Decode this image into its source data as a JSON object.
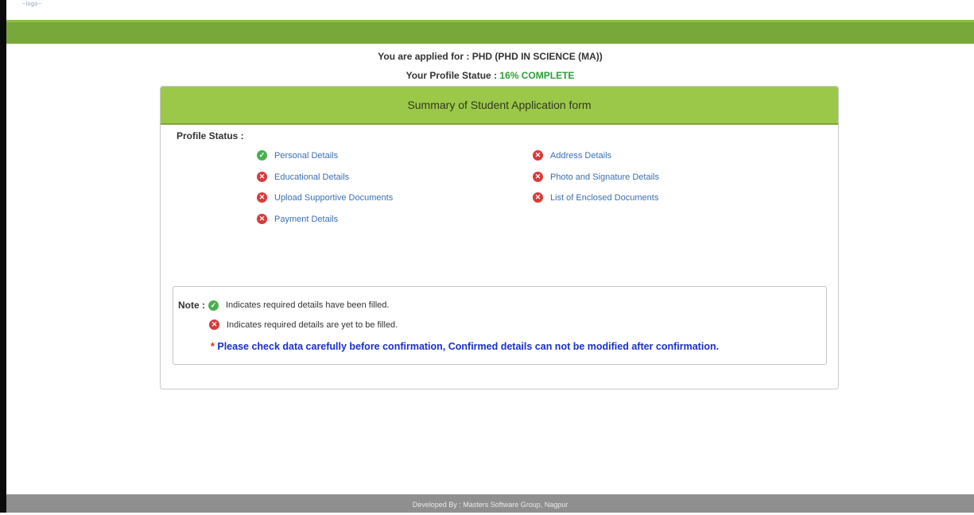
{
  "header": {
    "logo_text": "~logo~"
  },
  "applied_for": {
    "label": "You are applied for :",
    "value": "PHD (PHD IN SCIENCE (MA))"
  },
  "profile_status": {
    "label": "Your Profile Statue :",
    "value": "16% COMPLETE"
  },
  "panel": {
    "title": "Summary of Student Application form",
    "profile_status_label": "Profile Status :"
  },
  "items": [
    {
      "label": "Personal Details",
      "status": "complete",
      "icon": "check-circle-icon"
    },
    {
      "label": "Address Details",
      "status": "incomplete",
      "icon": "x-circle-icon"
    },
    {
      "label": "Educational Details",
      "status": "incomplete",
      "icon": "x-circle-icon"
    },
    {
      "label": "Photo and Signature Details",
      "status": "incomplete",
      "icon": "x-circle-icon"
    },
    {
      "label": "Upload Supportive Documents",
      "status": "incomplete",
      "icon": "x-circle-icon"
    },
    {
      "label": "List of Enclosed Documents",
      "status": "incomplete",
      "icon": "x-circle-icon"
    },
    {
      "label": "Payment Details",
      "status": "incomplete",
      "icon": "x-circle-icon"
    }
  ],
  "note": {
    "label": "Note :",
    "filled_text": "Indicates required details have been filled.",
    "not_filled_text": "Indicates required details are yet to be filled.",
    "warning_star": "*",
    "warning_text": "Please check data carefully before confirmation, Confirmed details can not be modified after confirmation."
  },
  "footer": {
    "text": "Developed By : Masters Software Group, Nagpur"
  },
  "colors": {
    "green_band": "#78a83a",
    "panel_header": "#9cc84a",
    "ok": "#4caf50",
    "error": "#d93a3a",
    "link": "#3a6fb5",
    "warning": "#1a2fcc"
  }
}
